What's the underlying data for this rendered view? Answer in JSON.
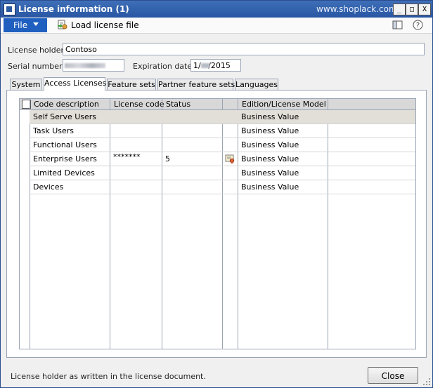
{
  "window": {
    "title": "License information (1)",
    "watermark": "www.shoplack.com",
    "controls": {
      "minimize": "_",
      "maximize": "□",
      "close": "X"
    }
  },
  "menu": {
    "file_label": "File",
    "load_license_label": "Load license file"
  },
  "form": {
    "license_holder_label": "License holder:",
    "license_holder_value": "Contoso",
    "serial_number_label": "Serial number:",
    "serial_number_value": "",
    "expiration_date_label": "Expiration date:",
    "expiration_date_value": "1/   /2015"
  },
  "tabs": [
    {
      "label": "System",
      "active": false
    },
    {
      "label": "Access Licenses",
      "active": true
    },
    {
      "label": "Feature sets",
      "active": false
    },
    {
      "label": "Partner feature sets",
      "active": false
    },
    {
      "label": "Languages",
      "active": false
    }
  ],
  "grid": {
    "columns": [
      "Code description",
      "License code",
      "Status",
      "",
      "Edition/License Model"
    ],
    "rows": [
      {
        "code_description": "Self Serve Users",
        "license_code": "",
        "status": "",
        "icon": "",
        "edition": "Business Value",
        "selected": true
      },
      {
        "code_description": "Task Users",
        "license_code": "",
        "status": "",
        "icon": "",
        "edition": "Business Value",
        "selected": false
      },
      {
        "code_description": "Functional Users",
        "license_code": "",
        "status": "",
        "icon": "",
        "edition": "Business Value",
        "selected": false
      },
      {
        "code_description": "Enterprise Users",
        "license_code": "*******",
        "status": "5",
        "icon": "certificate-icon",
        "edition": "Business Value",
        "selected": false
      },
      {
        "code_description": "Limited Devices",
        "license_code": "",
        "status": "",
        "icon": "",
        "edition": "Business Value",
        "selected": false
      },
      {
        "code_description": "Devices",
        "license_code": "",
        "status": "",
        "icon": "",
        "edition": "Business Value",
        "selected": false
      }
    ]
  },
  "statusbar": {
    "text": "License holder as written in the license document.",
    "close_label": "Close"
  },
  "colors": {
    "titlebar": "#2956a3",
    "file_button": "#1f5fbf",
    "selected_row": "#e2dfd8",
    "header": "#d8d8d8"
  }
}
